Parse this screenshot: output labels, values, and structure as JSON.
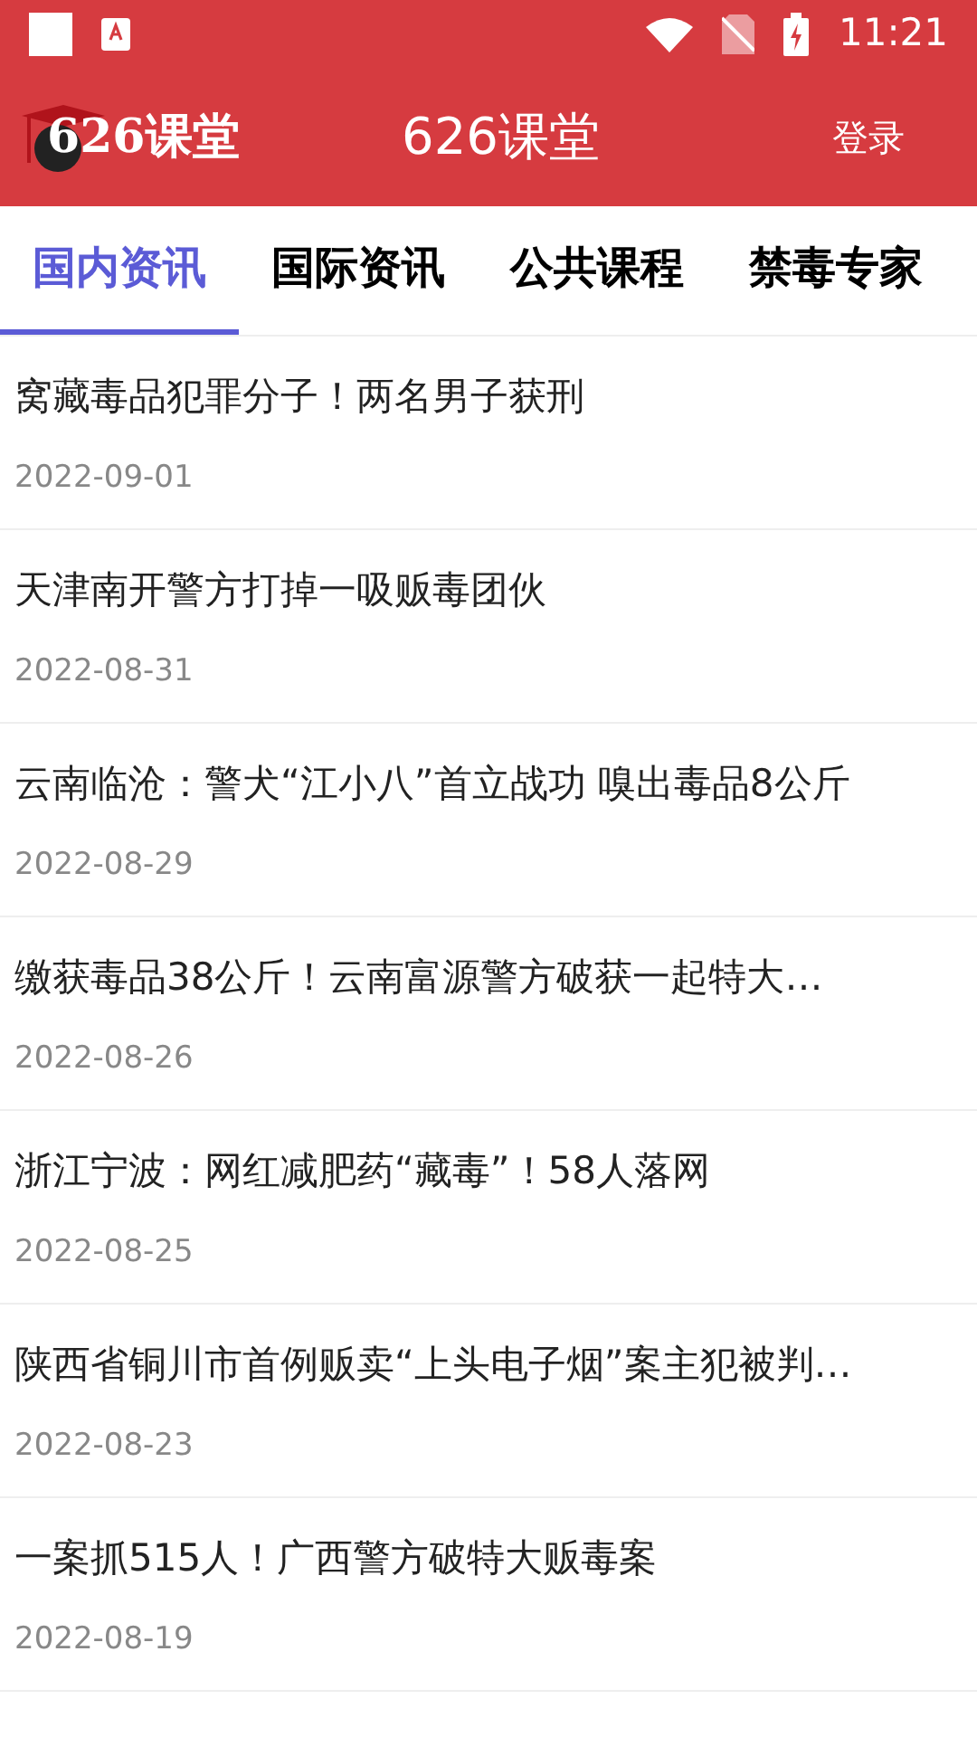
{
  "status_bar": {
    "time": "11:21"
  },
  "header": {
    "logo_text": "626课堂",
    "title": "626课堂",
    "login": "登录"
  },
  "tabs": [
    {
      "label": "国内资讯",
      "selected": true
    },
    {
      "label": "国际资讯",
      "selected": false
    },
    {
      "label": "公共课程",
      "selected": false
    },
    {
      "label": "禁毒专家",
      "selected": false
    }
  ],
  "news": [
    {
      "title": "窝藏毒品犯罪分子！两名男子获刑",
      "date": "2022-09-01"
    },
    {
      "title": "天津南开警方打掉一吸贩毒团伙",
      "date": "2022-08-31"
    },
    {
      "title": "云南临沧：警犬“江小八”首立战功 嗅出毒品8公斤",
      "date": "2022-08-29"
    },
    {
      "title": "缴获毒品38公斤！云南富源警方破获一起特大…",
      "date": "2022-08-26"
    },
    {
      "title": "浙江宁波：网红减肥药“藏毒”！58人落网",
      "date": "2022-08-25"
    },
    {
      "title": "陕西省铜川市首例贩卖“上头电子烟”案主犯被判…",
      "date": "2022-08-23"
    },
    {
      "title": "一案抓515人！广西警方破特大贩毒案",
      "date": "2022-08-19"
    }
  ]
}
